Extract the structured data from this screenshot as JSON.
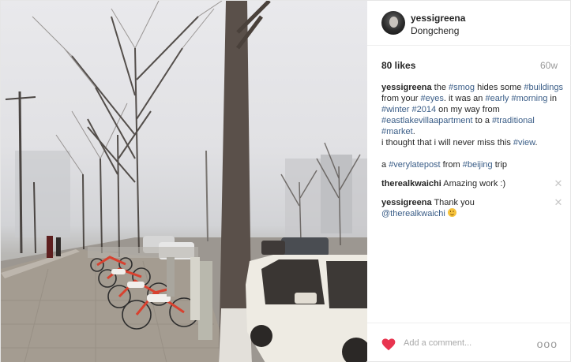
{
  "post": {
    "username": "yessigreena",
    "location": "Dongcheng",
    "likes": "80 likes",
    "age": "60w"
  },
  "caption": {
    "user": "yessigreena",
    "parts": [
      {
        "t": " the "
      },
      {
        "tag": "#smog"
      },
      {
        "t": " hides some "
      },
      {
        "tag": "#buildings"
      },
      {
        "t": " from your "
      },
      {
        "tag": "#eyes"
      },
      {
        "t": ". it was an "
      },
      {
        "tag": "#early"
      },
      {
        "t": " "
      },
      {
        "tag": "#morning"
      },
      {
        "t": " in "
      },
      {
        "tag": "#winter"
      },
      {
        "t": " "
      },
      {
        "tag": "#2014"
      },
      {
        "t": " on my way from "
      },
      {
        "tag": "#eastlakevillaapartment"
      },
      {
        "t": " to a "
      },
      {
        "tag": "#traditional"
      },
      {
        "t": " "
      },
      {
        "tag": "#market"
      },
      {
        "t": "."
      },
      {
        "br": true
      },
      {
        "t": "i thought that i will never miss this "
      },
      {
        "tag": "#view"
      },
      {
        "t": "."
      },
      {
        "br": true
      },
      {
        "br": true
      },
      {
        "t": "a "
      },
      {
        "tag": "#verylatepost"
      },
      {
        "t": " from "
      },
      {
        "tag": "#beijing"
      },
      {
        "t": " trip"
      }
    ]
  },
  "comments": [
    {
      "user": "therealkwaichi",
      "text": " Amazing work :)"
    },
    {
      "user": "yessigreena",
      "text": " Thank you ",
      "mention": "@therealkwaichi",
      "emoji": "smile"
    }
  ],
  "footer": {
    "placeholder": "Add a comment...",
    "more": "ooo"
  },
  "colors": {
    "heart": "#e8344f",
    "hashtag": "#3a5d87"
  },
  "icons": [
    "heart-icon",
    "close-icon",
    "more-options-icon",
    "smile-emoji"
  ]
}
